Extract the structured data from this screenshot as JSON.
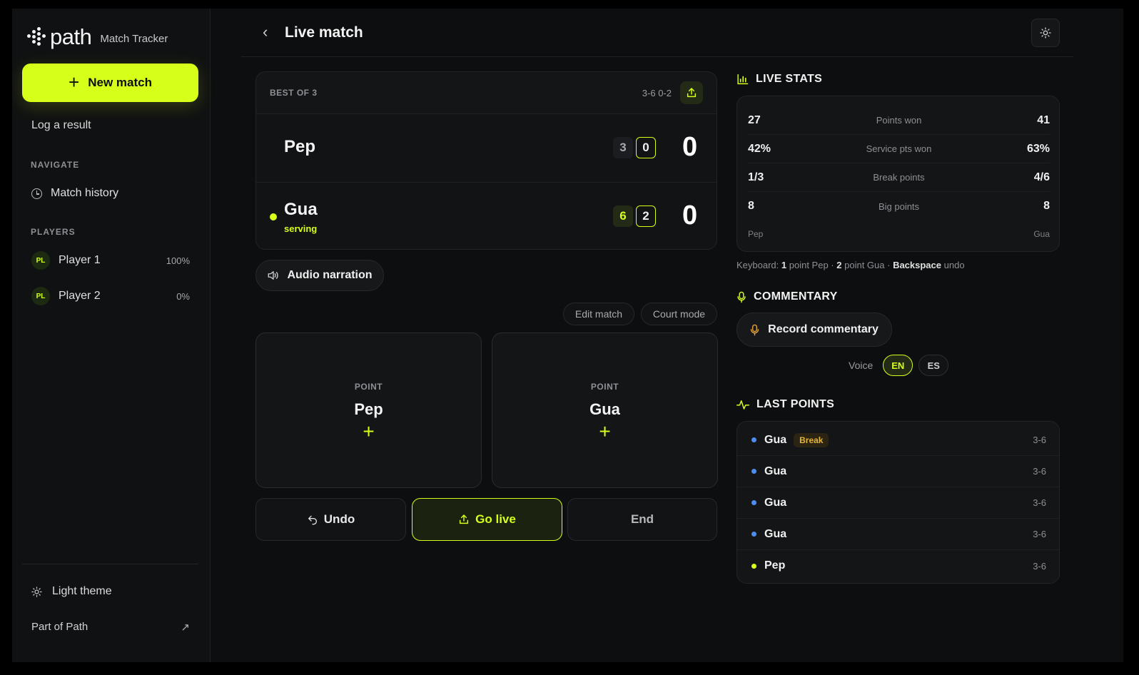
{
  "colors": {
    "accent": "#d6ff1a",
    "background": "#0d0e0f",
    "dot_pep": "#d6ff1a",
    "dot_gua": "#4d8cf0",
    "break_badge": "#e2b53a"
  },
  "brand": {
    "name": "path",
    "product": "Match Tracker"
  },
  "sidebar": {
    "new_match": "New match",
    "log_result": "Log a result",
    "navigate_label": "NAVIGATE",
    "nav_items": [
      {
        "label": "Match history",
        "icon": "clock-icon"
      }
    ],
    "players_label": "PLAYERS",
    "players": [
      {
        "initials": "PL",
        "name": "Player 1",
        "pct": "100%"
      },
      {
        "initials": "PL",
        "name": "Player 2",
        "pct": "0%"
      }
    ],
    "theme_toggle": "Light theme",
    "part_of": "Part of Path"
  },
  "header": {
    "back_icon": "chevron-left-icon",
    "title": "Live match",
    "theme_icon": "sun-icon"
  },
  "scoreboard": {
    "format": "BEST OF 3",
    "sets_summary": "3-6 0-2",
    "players": [
      {
        "name": "Pep",
        "set1": "3",
        "games": "0",
        "points": "0",
        "serving": false
      },
      {
        "name": "Gua",
        "set1": "6",
        "games": "2",
        "points": "0",
        "serving": true,
        "serving_label": "serving"
      }
    ]
  },
  "controls": {
    "audio_narration": "Audio narration",
    "edit_match": "Edit match",
    "court_mode": "Court mode",
    "point_label": "POINT",
    "point_players": [
      "Pep",
      "Gua"
    ],
    "undo": "Undo",
    "go_live": "Go live",
    "end": "End"
  },
  "live_stats": {
    "title": "LIVE STATS",
    "rows": [
      {
        "left": "27",
        "label": "Points won",
        "right": "41"
      },
      {
        "left": "42%",
        "label": "Service pts won",
        "right": "63%"
      },
      {
        "left": "1/3",
        "label": "Break points",
        "right": "4/6"
      },
      {
        "left": "8",
        "label": "Big points",
        "right": "8"
      }
    ],
    "left_player": "Pep",
    "right_player": "Gua"
  },
  "keyboard_hint": {
    "prefix": "Keyboard:",
    "k1": "1",
    "t1": "point Pep ·",
    "k2": "2",
    "t2": "point Gua ·",
    "k3": "Backspace",
    "t3": "undo"
  },
  "commentary": {
    "title": "COMMENTARY",
    "record": "Record commentary",
    "voice_label": "Voice",
    "languages": [
      {
        "code": "EN",
        "selected": true
      },
      {
        "code": "ES",
        "selected": false
      }
    ]
  },
  "last_points": {
    "title": "LAST POINTS",
    "items": [
      {
        "winner": "Gua",
        "badge": "Break",
        "score": "3-6"
      },
      {
        "winner": "Gua",
        "badge": "",
        "score": "3-6"
      },
      {
        "winner": "Gua",
        "badge": "",
        "score": "3-6"
      },
      {
        "winner": "Gua",
        "badge": "",
        "score": "3-6"
      },
      {
        "winner": "Pep",
        "badge": "",
        "score": "3-6"
      }
    ]
  }
}
